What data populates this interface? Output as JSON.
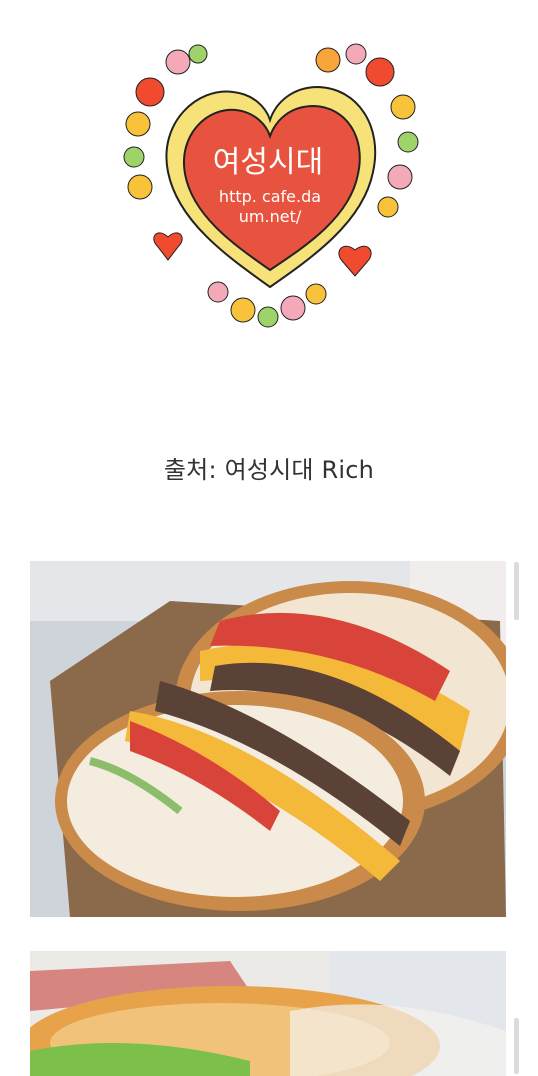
{
  "logo": {
    "title": "여성시대",
    "url_line1": "http. cafe.da",
    "url_line2": "um.net/"
  },
  "source_caption": "출처: 여성시대 Rich",
  "images": [
    {
      "name": "burger-cross-section-photo"
    },
    {
      "name": "chicken-burger-photo"
    }
  ],
  "colors": {
    "heart_red": "#e8533f",
    "heart_yellow": "#f7e27a",
    "text": "#333333"
  }
}
